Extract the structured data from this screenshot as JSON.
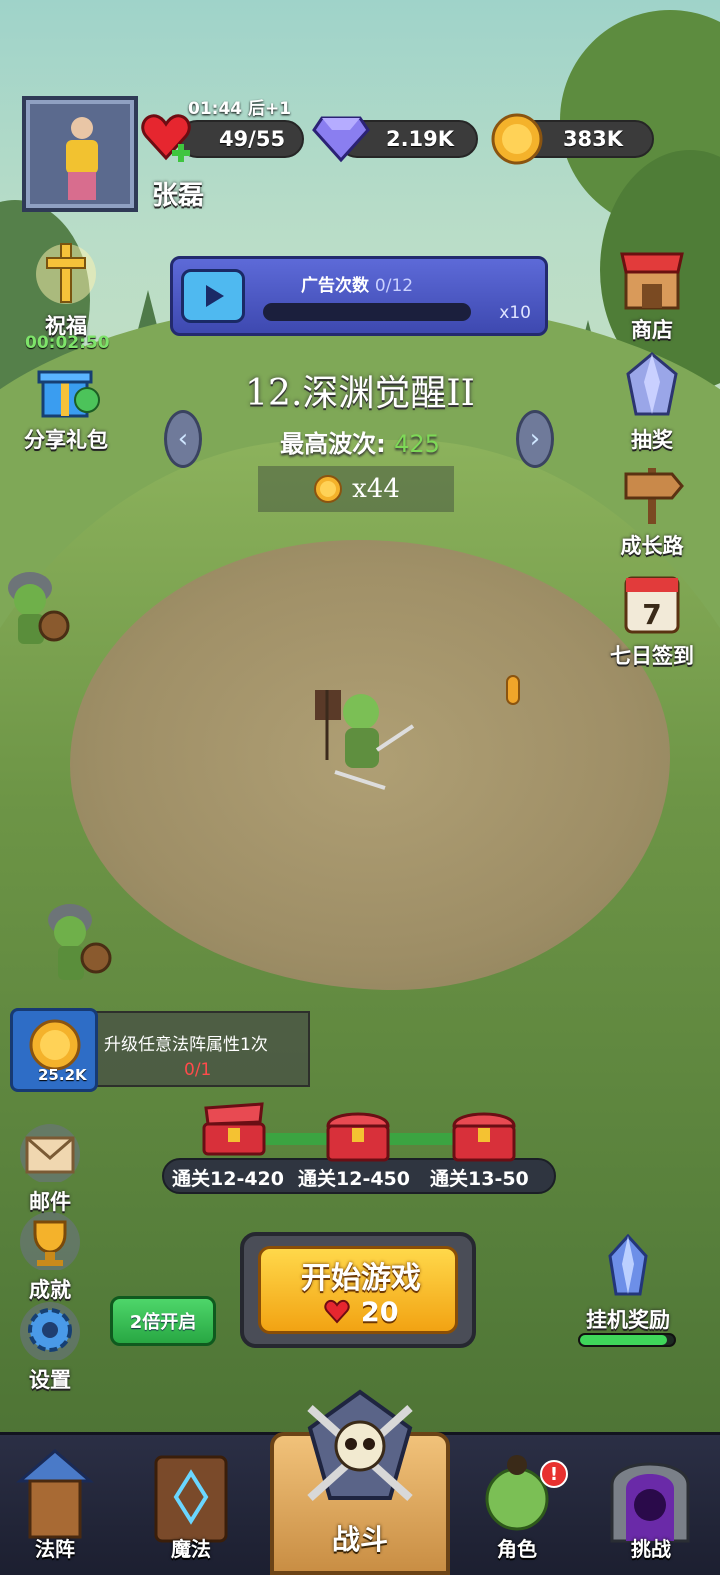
{
  "player": {
    "name": "张磊",
    "energy_timer": "01:44 后+1"
  },
  "resources": {
    "energy": "49/55",
    "gems": "2.19K",
    "gold": "383K"
  },
  "ad": {
    "label": "广告次数",
    "count": "0/12",
    "multiplier": "x10",
    "progress": 0
  },
  "stage": {
    "title": "12.深渊觉醒II",
    "wave_label": "最高波次:",
    "wave_value": "425",
    "reward": "x44"
  },
  "left_menu": {
    "bless": {
      "label": "祝福",
      "timer": "00:02:50"
    },
    "share": {
      "label": "分享礼包"
    },
    "mail": {
      "label": "邮件"
    },
    "achievement": {
      "label": "成就"
    },
    "settings": {
      "label": "设置"
    }
  },
  "right_menu": {
    "shop": {
      "label": "商店"
    },
    "lottery": {
      "label": "抽奖"
    },
    "growth": {
      "label": "成长路"
    },
    "checkin": {
      "label": "七日签到",
      "day": "7"
    },
    "idle": {
      "label": "挂机奖励",
      "progress": 0.93
    }
  },
  "quest": {
    "title": "升级任意法阵属性1次",
    "progress": "0/1",
    "reward": "25.2K"
  },
  "chests": [
    {
      "label": "通关12-420"
    },
    {
      "label": "通关12-450"
    },
    {
      "label": "通关13-50"
    }
  ],
  "start": {
    "label": "开始游戏",
    "cost": "20"
  },
  "double": {
    "label": "2倍开启"
  },
  "nav": {
    "array": "法阵",
    "magic": "魔法",
    "battle": "战斗",
    "role": "角色",
    "challenge": "挑战",
    "role_badge": "!"
  },
  "colors": {
    "wave_value": "#7ed957",
    "quest_progress": "#ff4b4b",
    "ad_bar": "#4e5bd0",
    "start_button": "#f2b41c"
  }
}
